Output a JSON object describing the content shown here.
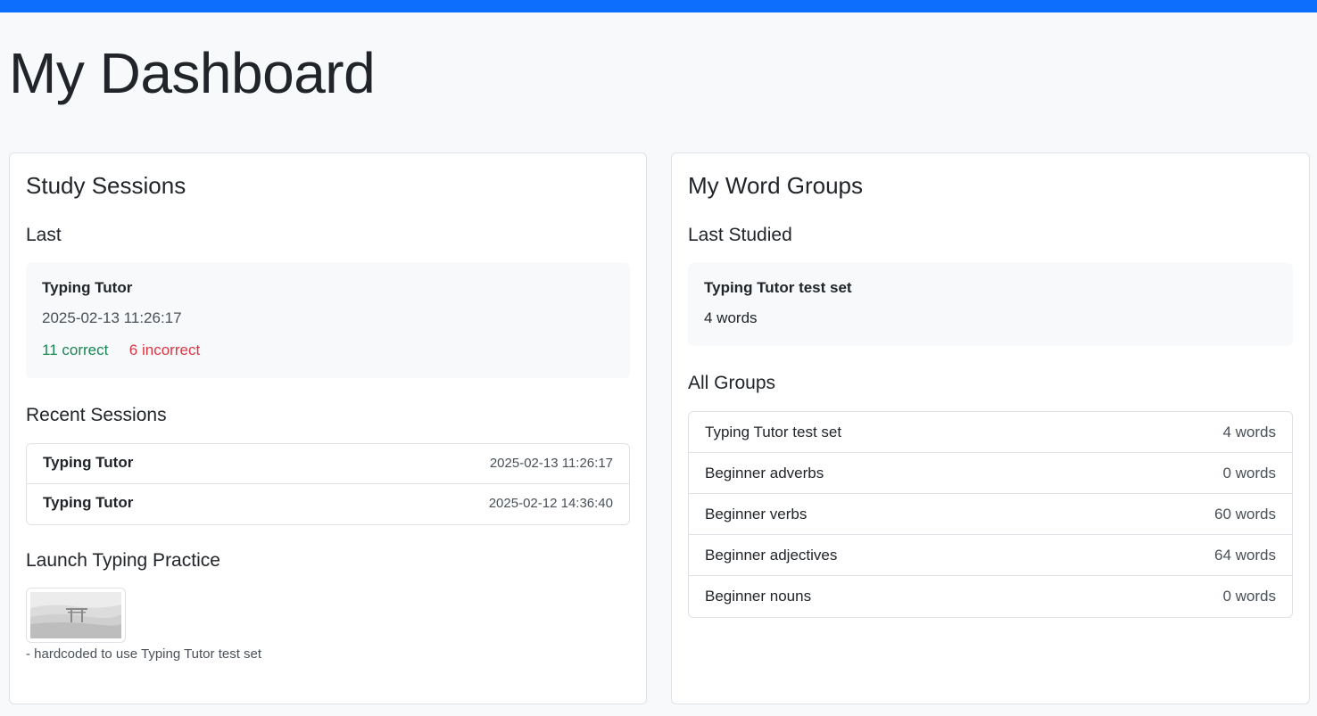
{
  "page": {
    "title": "My Dashboard"
  },
  "colors": {
    "accent": "#0d6efd",
    "success": "#198754",
    "danger": "#dc3545"
  },
  "study": {
    "title": "Study Sessions",
    "last_heading": "Last",
    "last": {
      "activity": "Typing Tutor",
      "timestamp": "2025-02-13 11:26:17",
      "correct": "11 correct",
      "incorrect": "6 incorrect"
    },
    "recent_heading": "Recent Sessions",
    "recent": [
      {
        "activity": "Typing Tutor",
        "timestamp": "2025-02-13 11:26:17"
      },
      {
        "activity": "Typing Tutor",
        "timestamp": "2025-02-12 14:36:40"
      }
    ],
    "launch_heading": "Launch Typing Practice",
    "launch_icon": "torii-gate-thumbnail",
    "launch_note": "- hardcoded to use Typing Tutor test set"
  },
  "groups": {
    "title": "My Word Groups",
    "last_heading": "Last Studied",
    "last": {
      "name": "Typing Tutor test set",
      "count": "4 words"
    },
    "all_heading": "All Groups",
    "all": [
      {
        "name": "Typing Tutor test set",
        "count": "4 words"
      },
      {
        "name": "Beginner adverbs",
        "count": "0 words"
      },
      {
        "name": "Beginner verbs",
        "count": "60 words"
      },
      {
        "name": "Beginner adjectives",
        "count": "64 words"
      },
      {
        "name": "Beginner nouns",
        "count": "0 words"
      }
    ]
  }
}
